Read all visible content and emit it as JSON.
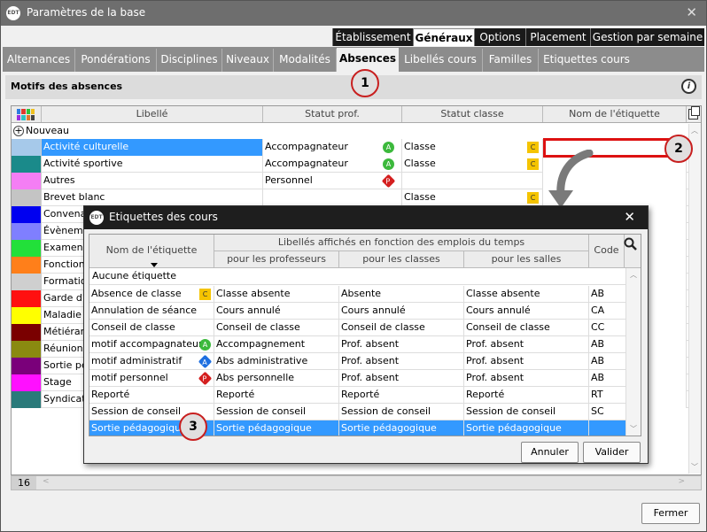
{
  "window": {
    "title": "Paramètres de la base",
    "logo": "EDT",
    "close": "✕"
  },
  "top_tabs": [
    {
      "label": "Établissement"
    },
    {
      "label": "Généraux"
    },
    {
      "label": "Options"
    },
    {
      "label": "Placement"
    },
    {
      "label": "Gestion par semaine"
    }
  ],
  "tabs": [
    {
      "label": "Alternances"
    },
    {
      "label": "Pondérations"
    },
    {
      "label": "Disciplines"
    },
    {
      "label": "Niveaux"
    },
    {
      "label": "Modalités"
    },
    {
      "label": "Absences"
    },
    {
      "label": "Libellés cours"
    },
    {
      "label": "Familles"
    },
    {
      "label": "Etiquettes cours"
    }
  ],
  "section": {
    "title": "Motifs des absences"
  },
  "callouts": {
    "one": "1",
    "two": "2",
    "three": "3"
  },
  "grid": {
    "headers": {
      "libelle": "Libellé",
      "statut_prof": "Statut prof.",
      "statut_classe": "Statut classe",
      "etiquette": "Nom de l'étiquette"
    },
    "nouveau": "Nouveau",
    "rows": [
      {
        "color": "#a6c9ea",
        "libelle": "Activité culturelle",
        "prof": "Accompagnateur",
        "prof_badge": "A",
        "classe": "Classe",
        "classe_badge": "C",
        "etiquette": ""
      },
      {
        "color": "#1a8a8a",
        "libelle": "Activité sportive",
        "prof": "Accompagnateur",
        "prof_badge": "A",
        "classe": "Classe",
        "classe_badge": "C",
        "etiquette": ""
      },
      {
        "color": "#f47ef4",
        "libelle": "Autres",
        "prof": "Personnel",
        "prof_badge": "P",
        "classe": "",
        "classe_badge": "",
        "etiquette": ""
      },
      {
        "color": "#c4c4c4",
        "libelle": "Brevet blanc",
        "prof": "",
        "prof_badge": "",
        "classe": "Classe",
        "classe_badge": "C",
        "etiquette": ""
      },
      {
        "color": "#0000f0",
        "libelle": "Convenan",
        "prof": "",
        "prof_badge": "",
        "classe": "",
        "classe_badge": "",
        "etiquette": ""
      },
      {
        "color": "#7f7fff",
        "libelle": "Évènemen",
        "prof": "",
        "prof_badge": "",
        "classe": "",
        "classe_badge": "",
        "etiquette": ""
      },
      {
        "color": "#22e03a",
        "libelle": "Examens",
        "prof": "",
        "prof_badge": "",
        "classe": "",
        "classe_badge": "",
        "etiquette": ""
      },
      {
        "color": "#ff7f1a",
        "libelle": "Fonctions",
        "prof": "",
        "prof_badge": "",
        "classe": "",
        "classe_badge": "",
        "etiquette": ""
      },
      {
        "color": "#cfcfcf",
        "libelle": "Formation",
        "prof": "",
        "prof_badge": "",
        "classe": "",
        "classe_badge": "",
        "etiquette": ""
      },
      {
        "color": "#ff1010",
        "libelle": "Garde d'e",
        "prof": "",
        "prof_badge": "",
        "classe": "",
        "classe_badge": "",
        "etiquette": ""
      },
      {
        "color": "#ffff00",
        "libelle": "Maladie",
        "prof": "",
        "prof_badge": "",
        "classe": "",
        "classe_badge": "",
        "etiquette": ""
      },
      {
        "color": "#7a0000",
        "libelle": "Métiérama",
        "prof": "",
        "prof_badge": "",
        "classe": "",
        "classe_badge": "",
        "etiquette": ""
      },
      {
        "color": "#8a8a10",
        "libelle": "Réunions",
        "prof": "",
        "prof_badge": "",
        "classe": "",
        "classe_badge": "",
        "etiquette": ""
      },
      {
        "color": "#7a007a",
        "libelle": "Sortie péd",
        "prof": "",
        "prof_badge": "",
        "classe": "",
        "classe_badge": "",
        "etiquette": ""
      },
      {
        "color": "#ff10ff",
        "libelle": "Stage",
        "prof": "",
        "prof_badge": "",
        "classe": "",
        "classe_badge": "",
        "etiquette": ""
      },
      {
        "color": "#2a7a7a",
        "libelle": "Syndicat",
        "prof": "",
        "prof_badge": "",
        "classe": "",
        "classe_badge": "",
        "etiquette": ""
      }
    ],
    "count": "16"
  },
  "close_button": "Fermer",
  "dialog": {
    "title": "Etiquettes des cours",
    "logo": "EDT",
    "close": "✕",
    "headers": {
      "nom": "Nom de l'étiquette",
      "group": "Libellés affichés en fonction des emplois du temps",
      "profs": "pour les professeurs",
      "classes": "pour les classes",
      "salles": "pour les salles",
      "code": "Code"
    },
    "aucune": "Aucune étiquette",
    "rows": [
      {
        "nom": "Absence de classe",
        "badge": "C",
        "profs": "Classe absente",
        "classes": "Absente",
        "salles": "Classe absente",
        "code": "AB"
      },
      {
        "nom": "Annulation de séance",
        "badge": "",
        "profs": "Cours annulé",
        "classes": "Cours annulé",
        "salles": "Cours annulé",
        "code": "CA"
      },
      {
        "nom": "Conseil de classe",
        "badge": "",
        "profs": "Conseil de classe",
        "classes": "Conseil de classe",
        "salles": "Conseil de classe",
        "code": "CC"
      },
      {
        "nom": "motif accompagnateur",
        "badge": "A",
        "profs": "Accompagnement",
        "classes": "Prof. absent",
        "salles": "Prof. absent",
        "code": "AB"
      },
      {
        "nom": "motif administratif",
        "badge": "A2",
        "profs": "Abs administrative",
        "classes": "Prof. absent",
        "salles": "Prof. absent",
        "code": "AB"
      },
      {
        "nom": "motif personnel",
        "badge": "P",
        "profs": "Abs personnelle",
        "classes": "Prof. absent",
        "salles": "Prof. absent",
        "code": "AB"
      },
      {
        "nom": "Reporté",
        "badge": "",
        "profs": "Reporté",
        "classes": "Reporté",
        "salles": "Reporté",
        "code": "RT"
      },
      {
        "nom": "Session de conseil",
        "badge": "",
        "profs": "Session de conseil",
        "classes": "Session de conseil",
        "salles": "Session de conseil",
        "code": "SC"
      },
      {
        "nom": "Sortie pédagogique",
        "badge": "",
        "profs": "Sortie pédagogique",
        "classes": "Sortie pédagogique",
        "salles": "Sortie pédagogique",
        "code": ""
      }
    ],
    "cancel": "Annuler",
    "validate": "Valider"
  },
  "colors": {
    "selection": "#3399ff",
    "accent_red": "#d11111",
    "badge_green": "#3cb93c",
    "badge_blue": "#1e6fe0",
    "badge_red": "#d41f1f",
    "badge_yellow": "#f5c400"
  }
}
